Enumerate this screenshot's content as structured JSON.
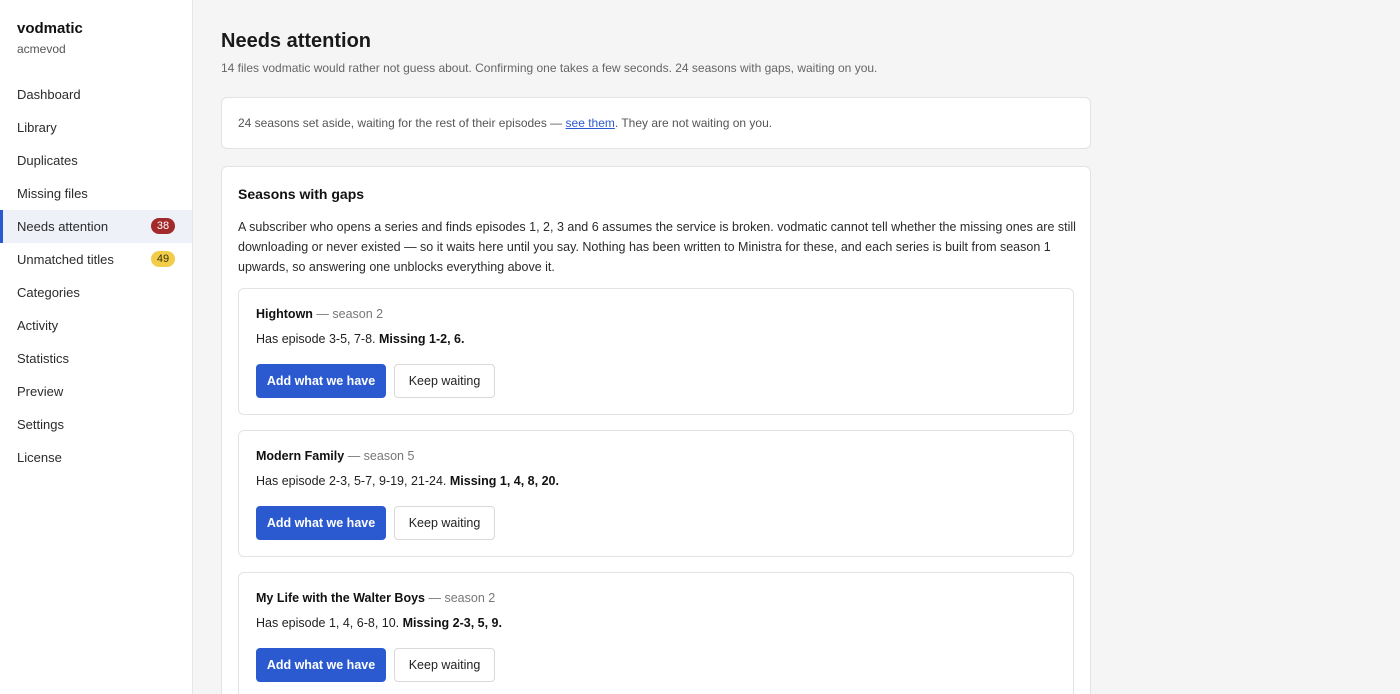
{
  "brand": {
    "name": "vodmatic",
    "account": "acmevod"
  },
  "sidebar": {
    "items": [
      {
        "label": "Dashboard"
      },
      {
        "label": "Library"
      },
      {
        "label": "Duplicates"
      },
      {
        "label": "Missing files"
      },
      {
        "label": "Needs attention",
        "badge": "38",
        "active": true
      },
      {
        "label": "Unmatched titles",
        "badge": "49"
      },
      {
        "label": "Categories"
      },
      {
        "label": "Activity"
      },
      {
        "label": "Statistics"
      },
      {
        "label": "Preview"
      },
      {
        "label": "Settings"
      },
      {
        "label": "License"
      }
    ]
  },
  "page": {
    "title": "Needs attention",
    "subtitle": "14 files vodmatic would rather not guess about. Confirming one takes a few seconds. 24 seasons with gaps, waiting on you."
  },
  "notice": {
    "before": "24 seasons set aside, waiting for the rest of their episodes — ",
    "link": "see them",
    "after": ". They are not waiting on you."
  },
  "panel": {
    "title": "Seasons with gaps",
    "description": "A subscriber who opens a series and finds episodes 1, 2, 3 and 6 assumes the service is broken. vodmatic cannot tell whether the missing ones are still downloading or never existed — so it waits here until you say. Nothing has been written to Ministra for these, and each series is built from season 1 upwards, so answering one unblocks everything above it.",
    "cards": [
      {
        "name": "Hightown",
        "season": " — season 2",
        "has": "Has episode 3-5, 7-8. ",
        "missing": "Missing 1-2, 6.",
        "add_label": "Add what we have",
        "wait_label": "Keep waiting"
      },
      {
        "name": "Modern Family",
        "season": " — season 5",
        "has": "Has episode 2-3, 5-7, 9-19, 21-24. ",
        "missing": "Missing 1, 4, 8, 20.",
        "add_label": "Add what we have",
        "wait_label": "Keep waiting"
      },
      {
        "name": "My Life with the Walter Boys",
        "season": " — season 2",
        "has": "Has episode 1, 4, 6-8, 10. ",
        "missing": "Missing 2-3, 5, 9.",
        "add_label": "Add what we have",
        "wait_label": "Keep waiting"
      }
    ]
  },
  "colors": {
    "accent": "#2b5ad0",
    "badge_red": "#a32a2a",
    "badge_yellow": "#f2cd4a"
  }
}
